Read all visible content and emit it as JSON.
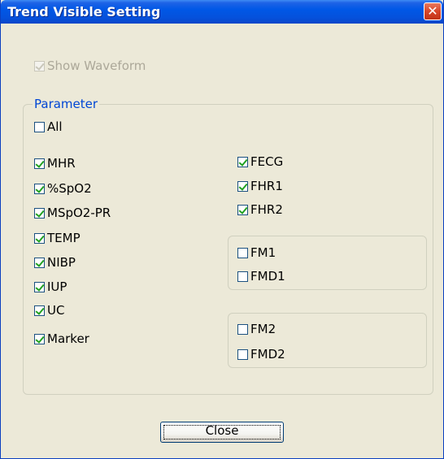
{
  "window": {
    "title": "Trend Visible Setting",
    "close_glyph": "✕"
  },
  "show_waveform": {
    "label": "Show Waveform",
    "checked": true,
    "enabled": false
  },
  "parameter_group": {
    "label": "Parameter",
    "all": {
      "label": "All",
      "checked": false
    },
    "left": [
      {
        "label": "MHR",
        "checked": true
      },
      {
        "label": "%SpO2",
        "checked": true
      },
      {
        "label": "MSpO2-PR",
        "checked": true
      },
      {
        "label": "TEMP",
        "checked": true
      },
      {
        "label": "NIBP",
        "checked": true
      },
      {
        "label": "IUP",
        "checked": true
      },
      {
        "label": "UC",
        "checked": true
      },
      {
        "label": "Marker",
        "checked": true
      }
    ],
    "right": [
      {
        "label": "FECG",
        "checked": true
      },
      {
        "label": "FHR1",
        "checked": true
      },
      {
        "label": "FHR2",
        "checked": true
      }
    ],
    "fm_box1": [
      {
        "label": "FM1",
        "checked": false
      },
      {
        "label": "FMD1",
        "checked": false
      }
    ],
    "fm_box2": [
      {
        "label": "FM2",
        "checked": false
      },
      {
        "label": "FMD2",
        "checked": false
      }
    ]
  },
  "buttons": {
    "close_label": "Close"
  },
  "colors": {
    "title_bar": "#0058e6",
    "group_label": "#0046d5",
    "check_mark": "#21a121"
  }
}
